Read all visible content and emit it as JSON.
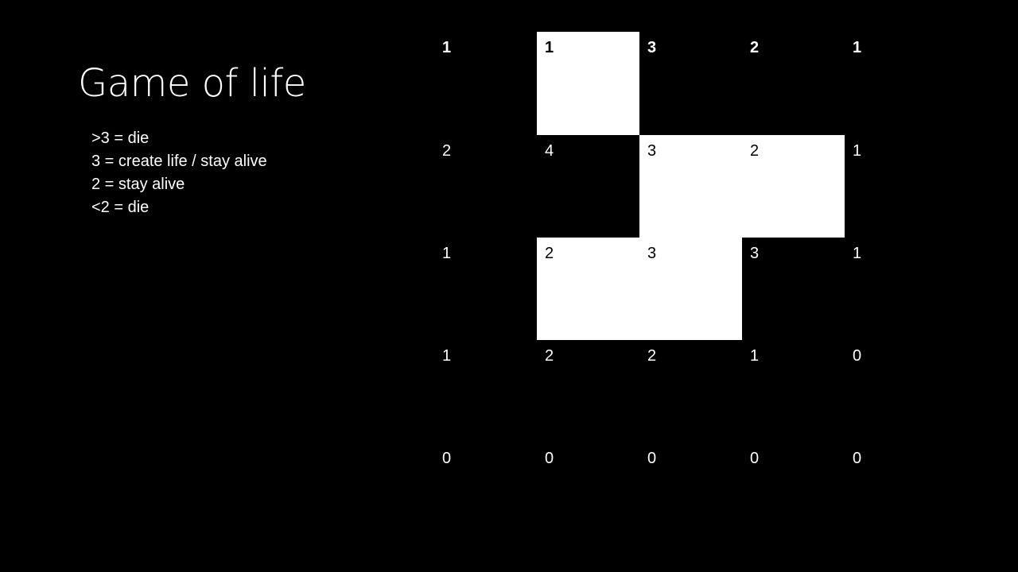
{
  "slide": {
    "title": "Game of life",
    "rules": [
      ">3 = die",
      "3 = create life / stay alive",
      "2 = stay alive",
      "<2 = die"
    ]
  },
  "grid": {
    "rows": [
      {
        "cells": [
          {
            "value": "1",
            "alive": false
          },
          {
            "value": "1",
            "alive": true
          },
          {
            "value": "3",
            "alive": false
          },
          {
            "value": "2",
            "alive": false
          },
          {
            "value": "1",
            "alive": false
          }
        ]
      },
      {
        "cells": [
          {
            "value": "2",
            "alive": false
          },
          {
            "value": "4",
            "alive": false
          },
          {
            "value": "3",
            "alive": true
          },
          {
            "value": "2",
            "alive": true
          },
          {
            "value": "1",
            "alive": false
          }
        ]
      },
      {
        "cells": [
          {
            "value": "1",
            "alive": false
          },
          {
            "value": "2",
            "alive": true
          },
          {
            "value": "3",
            "alive": true
          },
          {
            "value": "3",
            "alive": false
          },
          {
            "value": "1",
            "alive": false
          }
        ]
      },
      {
        "cells": [
          {
            "value": "1",
            "alive": false
          },
          {
            "value": "2",
            "alive": false
          },
          {
            "value": "2",
            "alive": false
          },
          {
            "value": "1",
            "alive": false
          },
          {
            "value": "0",
            "alive": false
          }
        ]
      },
      {
        "cells": [
          {
            "value": "0",
            "alive": false
          },
          {
            "value": "0",
            "alive": false
          },
          {
            "value": "0",
            "alive": false
          },
          {
            "value": "0",
            "alive": false
          },
          {
            "value": "0",
            "alive": false
          }
        ]
      }
    ]
  },
  "colors": {
    "background": "#000000",
    "text": "#ffffff",
    "alive_cell": "#ffffff",
    "alive_text": "#000000"
  }
}
